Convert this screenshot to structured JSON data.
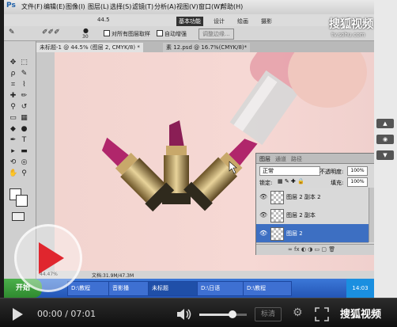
{
  "menubar": {
    "app_logo": "Ps",
    "items": [
      "文件(F)",
      "编辑(E)",
      "图像(I)",
      "图层(L)",
      "选择(S)",
      "滤镜(T)",
      "分析(A)",
      "视图(V)",
      "窗口(W)",
      "帮助(H)"
    ],
    "zoom_value": "44.5",
    "workspace_buttons": [
      "基本功能",
      "设计",
      "绘画",
      "摄影"
    ]
  },
  "options": {
    "size_value": "30",
    "sample_all_layers": "对所有图层取样",
    "auto_enhance": "自动增强",
    "refine_edge": "调整边缘..."
  },
  "tabs": [
    "未标题-1 @ 44.5% (图层 2, CMYK/8) *",
    "素 12.psd @ 16.7%(CMYK/8)*"
  ],
  "layers_panel": {
    "tabs": [
      "图层",
      "通道",
      "路径"
    ],
    "blend_mode": "正常",
    "opacity_label": "不透明度:",
    "opacity_value": "100%",
    "lock_label": "锁定:",
    "fill_label": "填充:",
    "fill_value": "100%",
    "layers": [
      {
        "name": "图层 2 副本 2",
        "selected": false
      },
      {
        "name": "图层 2 副本",
        "selected": false
      },
      {
        "name": "图层 2",
        "selected": true
      }
    ]
  },
  "status": {
    "zoom": "44.47%",
    "doc": "文档:31.9M/47.3M"
  },
  "taskbar": {
    "start": "开始",
    "tasks": [
      "D:\\教程",
      "音影播",
      "未标题",
      "D:\\日语",
      "D:\\教程"
    ],
    "clock": "14:03"
  },
  "watermark": {
    "brand": "搜狐视频",
    "url": "tv.sohu.com"
  },
  "player": {
    "current_time": "00:00",
    "separator": "/",
    "duration": "07:01",
    "quality_button": "标清",
    "brand": "搜狐视频",
    "volume_level": 0.7
  },
  "colors": {
    "taskbar_blue": "#2455b5",
    "start_green": "#3a9a3a",
    "layer_selected": "#3d6fc2",
    "canvas_pink": "#f4d6d2"
  }
}
